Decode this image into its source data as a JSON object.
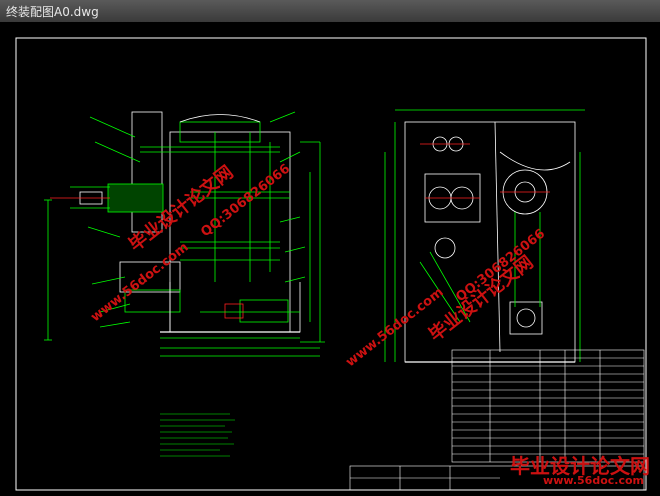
{
  "window": {
    "title": "终装配图A0.dwg"
  },
  "watermarks": {
    "site_cn": "毕业设计论文网",
    "site_url": "www.56doc.com",
    "qq": "QQ:306826066"
  },
  "footer_logo": {
    "cn": "毕业设计论文网",
    "url": "www.56doc.com"
  },
  "colors": {
    "background": "#000000",
    "frame": "#ffffff",
    "drawing_green": "#00ff00",
    "drawing_white": "#ffffff",
    "drawing_red": "#ff2020",
    "watermark_red": "#cc1111",
    "titlebar": "#4a4a4a"
  }
}
